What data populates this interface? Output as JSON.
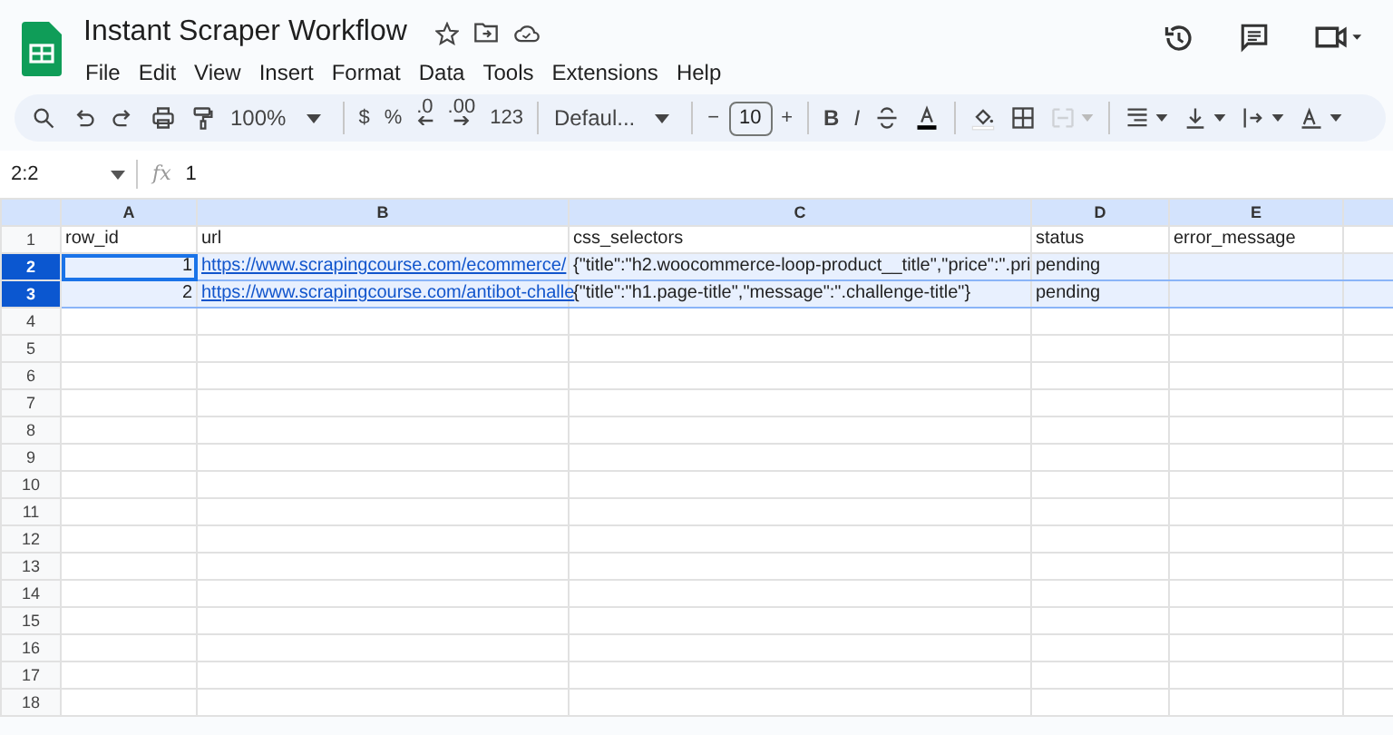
{
  "app": {
    "title": "Instant Scraper Workflow",
    "menus": [
      "File",
      "Edit",
      "View",
      "Insert",
      "Format",
      "Data",
      "Tools",
      "Extensions",
      "Help"
    ]
  },
  "toolbar": [
    {
      "kind": "icon"
    },
    {
      "kind": "icon"
    },
    {
      "kind": "icon"
    },
    {
      "kind": "icon"
    },
    {
      "kind": "icon"
    },
    {
      "kind": "dropdown",
      "label": "100%"
    },
    {
      "kind": "sep"
    },
    {
      "kind": "text",
      "label": "$"
    },
    {
      "kind": "text",
      "label": "%"
    },
    {
      "kind": "decimal-less",
      "label": ".0"
    },
    {
      "kind": "decimal-more",
      "label": ".00"
    },
    {
      "kind": "text",
      "label": "123"
    },
    {
      "kind": "sep"
    },
    {
      "kind": "dropdown",
      "label": "Defaul..."
    },
    {
      "kind": "sep"
    },
    {
      "kind": "text",
      "label": "−"
    },
    {
      "kind": "field",
      "label": "10"
    },
    {
      "kind": "text",
      "label": "+"
    },
    {
      "kind": "sep"
    },
    {
      "kind": "bold",
      "label": "B"
    },
    {
      "kind": "italic",
      "label": "I"
    },
    {
      "kind": "icon"
    },
    {
      "kind": "icon"
    },
    {
      "kind": "sep"
    },
    {
      "kind": "icon"
    },
    {
      "kind": "icon"
    },
    {
      "kind": "icon",
      "disabled": true
    },
    {
      "kind": "sep"
    },
    {
      "kind": "icon"
    },
    {
      "kind": "icon"
    },
    {
      "kind": "icon"
    },
    {
      "kind": "icon"
    }
  ],
  "formula_bar": {
    "cell_ref": "2:2",
    "fx_label": "fx",
    "value": "1"
  },
  "sheet": {
    "columns": [
      "A",
      "B",
      "C",
      "D",
      "E",
      ""
    ],
    "rows": [
      {
        "number": "1",
        "selected": false,
        "cells": [
          {
            "text": "row_id"
          },
          {
            "text": "url"
          },
          {
            "text": "css_selectors"
          },
          {
            "text": "status"
          },
          {
            "text": "error_message"
          },
          {
            "text": ""
          }
        ]
      },
      {
        "number": "2",
        "selected": true,
        "cells": [
          {
            "text": "1",
            "active": true
          },
          {
            "text": "https://www.scrapingcourse.com/ecommerce/",
            "kind": "link"
          },
          {
            "text": "{\"title\":\"h2.woocommerce-loop-product__title\",\"price\":\".pri"
          },
          {
            "text": "pending"
          },
          {
            "text": ""
          },
          {
            "text": ""
          }
        ]
      },
      {
        "number": "3",
        "selected": true,
        "cells": [
          {
            "text": "2"
          },
          {
            "text": "https://www.scrapingcourse.com/antibot-challe",
            "kind": "link"
          },
          {
            "text": "{\"title\":\"h1.page-title\",\"message\":\".challenge-title\"}"
          },
          {
            "text": "pending"
          },
          {
            "text": ""
          },
          {
            "text": ""
          }
        ]
      },
      {
        "number": "4",
        "selected": false
      },
      {
        "number": "5",
        "selected": false
      },
      {
        "number": "6",
        "selected": false
      },
      {
        "number": "7",
        "selected": false
      },
      {
        "number": "8",
        "selected": false
      },
      {
        "number": "9",
        "selected": false
      },
      {
        "number": "10",
        "selected": false
      },
      {
        "number": "11",
        "selected": false
      },
      {
        "number": "12",
        "selected": false
      },
      {
        "number": "13",
        "selected": false
      },
      {
        "number": "14",
        "selected": false
      },
      {
        "number": "15",
        "selected": false
      },
      {
        "number": "16",
        "selected": false
      },
      {
        "number": "17",
        "selected": false
      },
      {
        "number": "18",
        "selected": false
      }
    ]
  }
}
